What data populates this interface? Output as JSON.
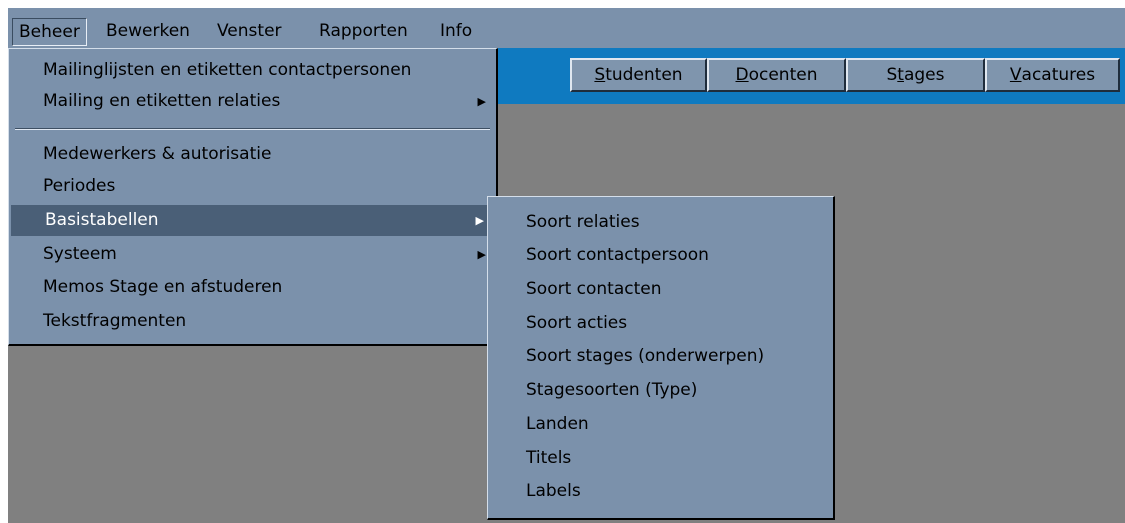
{
  "menubar": {
    "items": [
      {
        "label": "Beheer"
      },
      {
        "label": "Bewerken"
      },
      {
        "label": "Venster"
      },
      {
        "label": "Rapporten"
      },
      {
        "label": "Info"
      }
    ]
  },
  "toolbar": {
    "buttons": [
      {
        "mnemonic": "S",
        "rest": "tudenten"
      },
      {
        "mnemonic": "D",
        "rest": "ocenten"
      },
      {
        "pre": "S",
        "mnemonic": "t",
        "rest": "ages"
      },
      {
        "mnemonic": "V",
        "rest": "acatures"
      }
    ]
  },
  "beheer_menu": {
    "items": [
      {
        "label": "Mailinglijsten en etiketten contactpersonen",
        "has_submenu": false
      },
      {
        "label": "Mailing en etiketten relaties",
        "has_submenu": true
      },
      {
        "label": "Medewerkers & autorisatie",
        "has_submenu": false
      },
      {
        "label": "Periodes",
        "has_submenu": false
      },
      {
        "label": "Basistabellen",
        "has_submenu": true,
        "selected": true
      },
      {
        "label": "Systeem",
        "has_submenu": true
      },
      {
        "label": "Memos Stage en afstuderen",
        "has_submenu": false
      },
      {
        "label": "Tekstfragmenten",
        "has_submenu": false
      }
    ],
    "submenu_arrow": "▶"
  },
  "basistabellen_menu": {
    "items": [
      {
        "label": "Soort relaties"
      },
      {
        "label": "Soort contactpersoon"
      },
      {
        "label": "Soort contacten"
      },
      {
        "label": "Soort acties"
      },
      {
        "label": "Soort stages (onderwerpen)"
      },
      {
        "label": "Stagesoorten (Type)"
      },
      {
        "label": "Landen"
      },
      {
        "label": "Titels"
      },
      {
        "label": "Labels"
      }
    ]
  },
  "colors": {
    "menu_bg": "#7b91ab",
    "toolbar_bg": "#0f7ac0",
    "workspace_bg": "#808080",
    "highlight_bg": "#4a5f77",
    "highlight_fg": "#ffffff"
  }
}
